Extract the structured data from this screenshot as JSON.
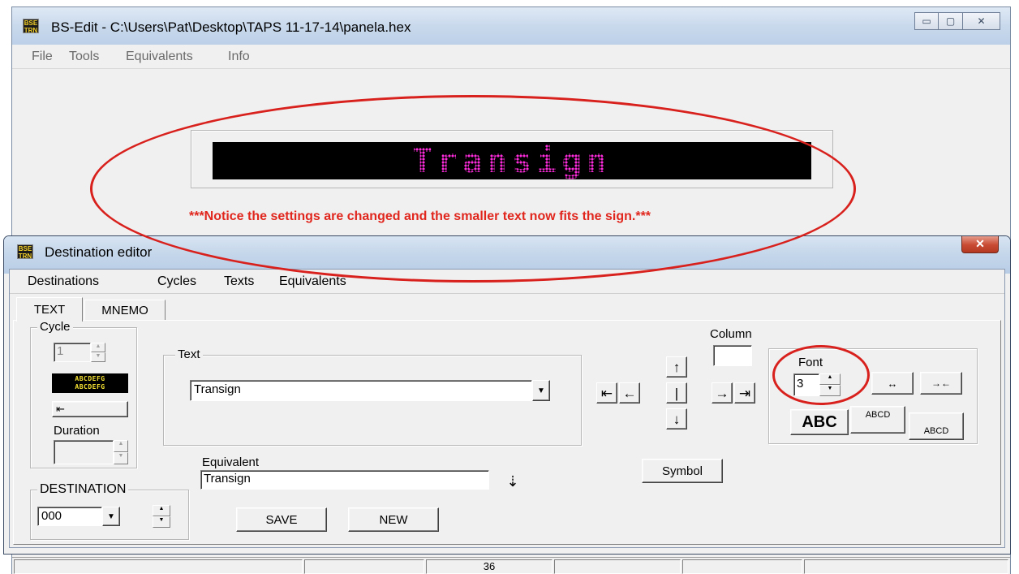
{
  "main_window": {
    "title": "BS-Edit - C:\\Users\\Pat\\Desktop\\TAPS 11-17-14\\panela.hex",
    "icon_text": [
      "BSE",
      "TRN"
    ],
    "menu": [
      "File",
      "Tools",
      "Equivalents",
      "Info"
    ],
    "caption_buttons": {
      "minimize": "▭",
      "maximize": "▢",
      "close": "✕"
    },
    "led_text": "Transign",
    "notice": "***Notice the settings are changed and the smaller text now fits the sign.***",
    "status_cells": [
      "",
      "",
      "36",
      "",
      "",
      ""
    ]
  },
  "dest_editor": {
    "title": "Destination editor",
    "close_glyph": "✕",
    "menu": [
      "Destinations",
      "Cycles",
      "Texts",
      "Equivalents"
    ],
    "tabs": [
      "TEXT",
      "MNEMO"
    ],
    "cycle": {
      "label": "Cycle",
      "value": "1",
      "scroll_sample_lines": [
        "ABCDEFG",
        "ABCDEFG"
      ],
      "scroll_glyph": "⇤",
      "duration_label": "Duration",
      "duration_value": ""
    },
    "destination": {
      "label": "DESTINATION",
      "value": "000"
    },
    "text_group": {
      "label": "Text",
      "value": "Transign"
    },
    "equivalent": {
      "label": "Equivalent",
      "value": "Transign",
      "button_glyph": "⇣"
    },
    "buttons": {
      "save": "SAVE",
      "new": "NEW",
      "symbol": "Symbol"
    },
    "column": {
      "label": "Column",
      "value": ""
    },
    "nav_glyphs": {
      "up": "↑",
      "down": "↓",
      "left": "←",
      "right": "→",
      "first": "⇤",
      "last": "⇥",
      "center": "|"
    },
    "font": {
      "label": "Font",
      "value": "3",
      "widen_glyph": "↔",
      "narrow_glyph": "→←",
      "size_buttons": [
        "ABC",
        "ABCD",
        "ABCD"
      ]
    }
  },
  "colors": {
    "led_magenta": "#ff2bdc",
    "annotation_red": "#d8201c",
    "notice_red": "#e0261d"
  }
}
